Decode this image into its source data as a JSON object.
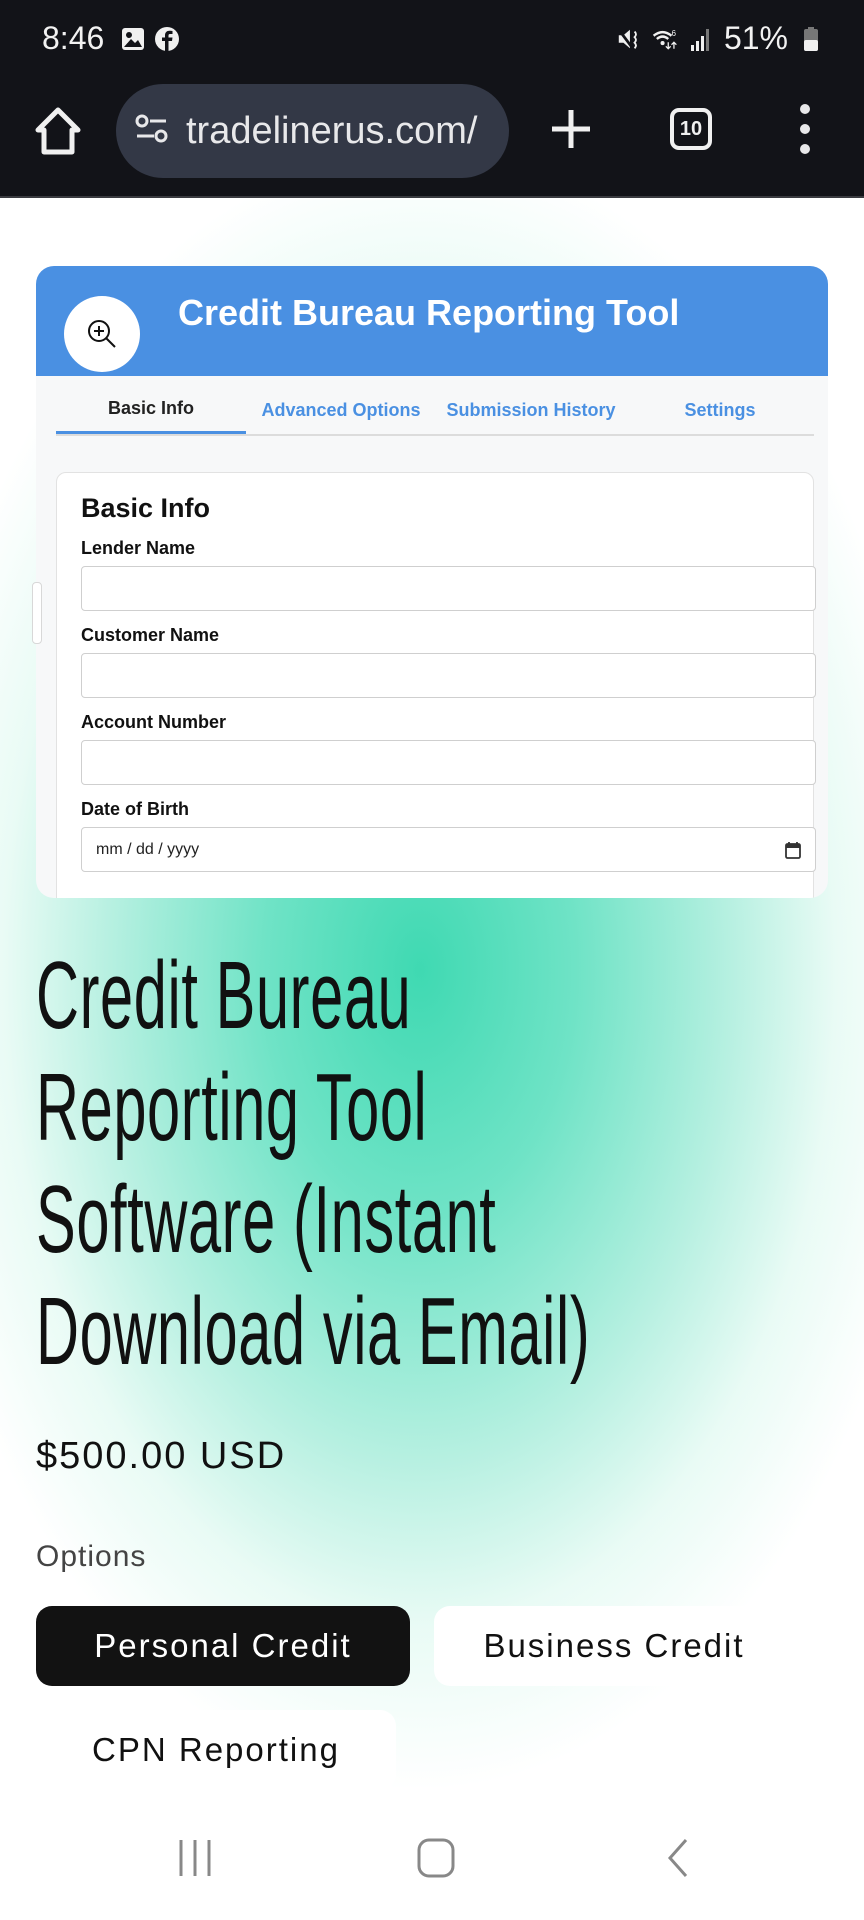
{
  "status_bar": {
    "time": "8:46",
    "left_icons": [
      "gallery-icon",
      "facebook-icon"
    ],
    "right_icons": [
      "mute-icon",
      "wifi-6-icon",
      "signal-icon"
    ],
    "battery": "51%"
  },
  "browser": {
    "url": "tradelinerus.com/",
    "tab_count": "10"
  },
  "screenshot_preview": {
    "title": "Credit Bureau Reporting Tool",
    "tabs": [
      {
        "label": "Basic Info",
        "active": true
      },
      {
        "label": "Advanced Options",
        "active": false
      },
      {
        "label": "Submission History",
        "active": false
      },
      {
        "label": "Settings",
        "active": false
      }
    ],
    "card_title": "Basic Info",
    "fields": [
      {
        "label": "Lender Name",
        "value": ""
      },
      {
        "label": "Customer Name",
        "value": ""
      },
      {
        "label": "Account Number",
        "value": ""
      },
      {
        "label": "Date of Birth",
        "placeholder": "mm / dd / yyyy"
      }
    ],
    "header_color": "#4a90e2"
  },
  "product": {
    "title_lines": [
      "Credit Bureau",
      "Reporting Tool",
      "Software (Instant",
      "Download via Email)"
    ],
    "price": "$500.00 USD",
    "options_label": "Options",
    "options": [
      {
        "label": "Personal Credit",
        "selected": true
      },
      {
        "label": "Business Credit",
        "selected": false
      },
      {
        "label": "CPN Reporting",
        "selected": false
      }
    ]
  },
  "nav": {
    "buttons": [
      "recents",
      "home",
      "back"
    ]
  }
}
